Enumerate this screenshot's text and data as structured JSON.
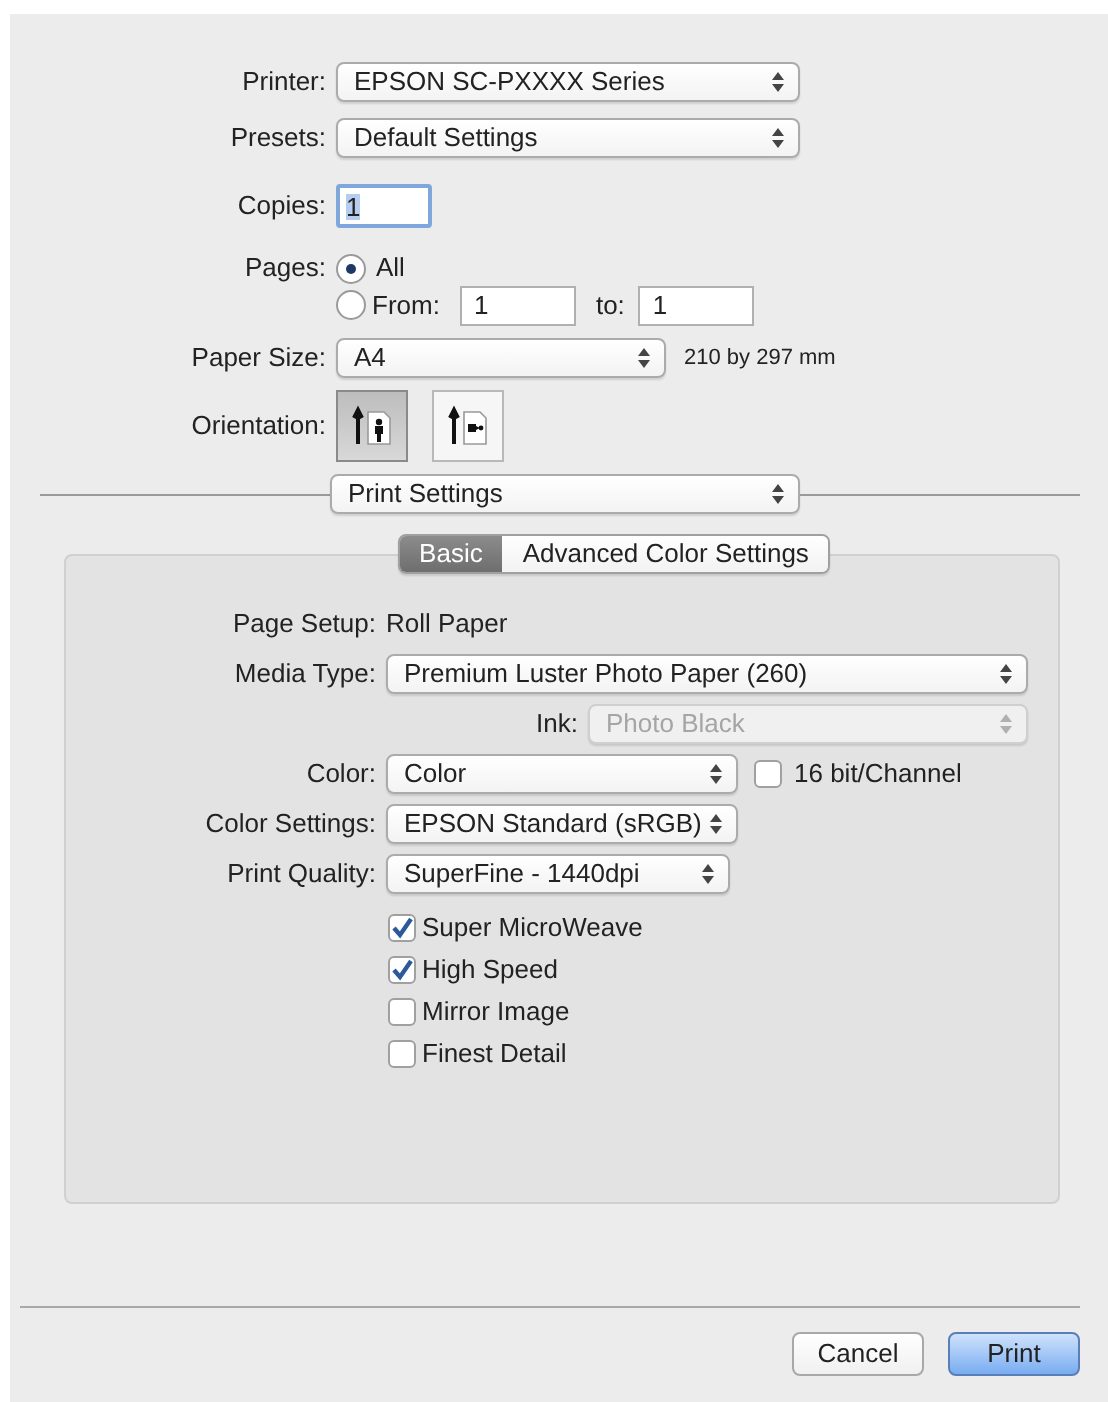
{
  "printer": {
    "label": "Printer:",
    "value": "EPSON SC-PXXXX Series"
  },
  "presets": {
    "label": "Presets:",
    "value": "Default Settings"
  },
  "copies": {
    "label": "Copies:",
    "value": "1"
  },
  "pages": {
    "label": "Pages:",
    "options": [
      {
        "label": "All",
        "selected": true
      },
      {
        "label": "From:",
        "selected": false
      }
    ],
    "from": "1",
    "to_label": "to:",
    "to": "1"
  },
  "paper_size": {
    "label": "Paper Size:",
    "value": "A4",
    "dimensions": "210 by 297 mm"
  },
  "orientation": {
    "label": "Orientation:",
    "options": [
      {
        "kind": "portrait",
        "selected": true
      },
      {
        "kind": "landscape",
        "selected": false
      }
    ]
  },
  "section_menu": {
    "value": "Print Settings"
  },
  "tabs": [
    {
      "label": "Basic",
      "selected": true
    },
    {
      "label": "Advanced Color Settings",
      "selected": false
    }
  ],
  "page_setup": {
    "label": "Page Setup:",
    "value": "Roll Paper"
  },
  "media_type": {
    "label": "Media Type:",
    "value": "Premium Luster Photo Paper (260)"
  },
  "ink": {
    "label": "Ink:",
    "value": "Photo Black",
    "disabled": true
  },
  "color": {
    "label": "Color:",
    "value": "Color",
    "option": {
      "label": "16 bit/Channel",
      "checked": false
    }
  },
  "color_settings": {
    "label": "Color Settings:",
    "value": "EPSON Standard (sRGB)"
  },
  "print_quality": {
    "label": "Print Quality:",
    "value": "SuperFine - 1440dpi"
  },
  "options": [
    {
      "label": "Super MicroWeave",
      "checked": true
    },
    {
      "label": "High Speed",
      "checked": true
    },
    {
      "label": "Mirror Image",
      "checked": false
    },
    {
      "label": "Finest Detail",
      "checked": false
    }
  ],
  "buttons": [
    {
      "label": "Cancel",
      "default": false
    },
    {
      "label": "Print",
      "default": true
    }
  ]
}
